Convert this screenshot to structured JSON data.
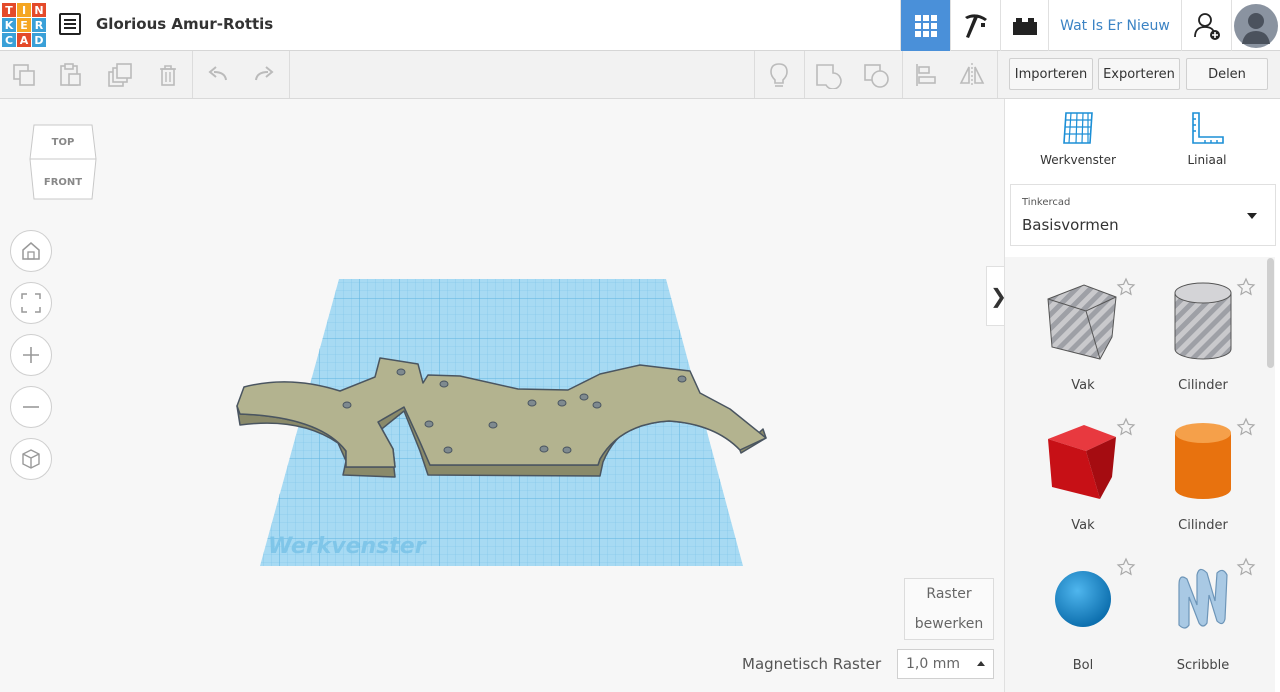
{
  "app": {
    "logo_letters": [
      "T",
      "I",
      "N",
      "K",
      "E",
      "R",
      "C",
      "A",
      "D"
    ],
    "logo_colors": [
      "#e44a2a",
      "#f5a623",
      "#e44a2a",
      "#3aa0d8",
      "#f5a623",
      "#3aa0d8",
      "#3aa0d8",
      "#e44a2a",
      "#3aa0d8"
    ],
    "design_title": "Glorious Amur-Rottis"
  },
  "topbar": {
    "whats_new": "Wat Is Er Nieuw",
    "icons": [
      "grid-view-icon",
      "pickaxe-icon",
      "brick-icon",
      "add-user-icon",
      "avatar"
    ]
  },
  "toolbar": {
    "import_label": "Importeren",
    "export_label": "Exporteren",
    "share_label": "Delen",
    "tools": [
      "copy-icon",
      "paste-icon",
      "duplicate-icon",
      "delete-icon",
      "undo-icon",
      "redo-icon",
      "light-bulb-icon",
      "group-icon",
      "ungroup-icon",
      "align-icon",
      "mirror-icon"
    ]
  },
  "viewcube": {
    "top": "TOP",
    "front": "FRONT"
  },
  "workplane": {
    "label": "Werkvenster"
  },
  "bottom": {
    "grid_edit_line1": "Raster",
    "grid_edit_line2": "bewerken",
    "snap_label": "Magnetisch Raster",
    "snap_value": "1,0 mm"
  },
  "panel": {
    "workplane_tool": "Werkvenster",
    "ruler_tool": "Liniaal",
    "library_source": "Tinkercad",
    "library_name": "Basisvormen",
    "shapes": [
      {
        "label": "Vak",
        "icon": "box-hole-icon"
      },
      {
        "label": "Cilinder",
        "icon": "cylinder-hole-icon"
      },
      {
        "label": "Vak",
        "icon": "box-icon"
      },
      {
        "label": "Cilinder",
        "icon": "cylinder-icon"
      },
      {
        "label": "Bol",
        "icon": "sphere-icon"
      },
      {
        "label": "Scribble",
        "icon": "scribble-icon"
      }
    ]
  },
  "colors": {
    "accent": "#4a90d9",
    "box_red": "#d9141e",
    "cylinder_orange": "#f07d17",
    "sphere_blue": "#1c8fd6",
    "grid_blue": "#9fd6f2",
    "part_color": "#b3b38f"
  }
}
